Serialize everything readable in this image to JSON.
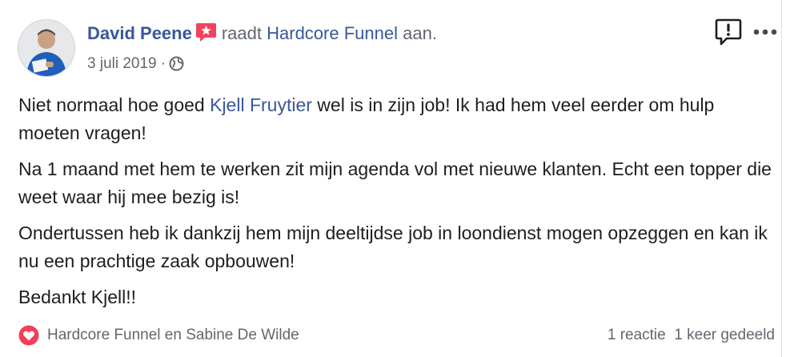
{
  "post": {
    "author": "David Peene",
    "recommends_text": "raadt",
    "page_name": "Hardcore Funnel",
    "recommends_suffix": "aan.",
    "date": "3 juli 2019",
    "separator": "·",
    "body": {
      "p1_before": "Niet normaal hoe goed ",
      "p1_mention": "Kjell Fruytier",
      "p1_after": " wel is in zijn job! Ik had hem veel eerder om hulp moeten vragen!",
      "p2": "Na 1 maand met hem te werken zit mijn agenda vol met nieuwe klanten. Echt een topper die weet waar hij mee bezig is!",
      "p3": "Ondertussen heb ik dankzij hem mijn deeltijdse job in loondienst mogen opzeggen en kan ik nu een prachtige zaak opbouwen!",
      "p4": "Bedankt Kjell!!"
    }
  },
  "footer": {
    "reactors": "Hardcore Funnel en Sabine De Wilde",
    "reactions_count": "1 reactie",
    "shares_count": "1 keer gedeeld"
  },
  "icons": {
    "recommend": "recommend-star-icon",
    "audience": "globe-icon",
    "report": "report-icon",
    "more": "more-options-icon",
    "reaction": "love-reaction-icon"
  },
  "colors": {
    "link": "#385898",
    "secondary_text": "#616770",
    "recommend_badge": "#f3425f",
    "love_reaction": "#f33e58"
  }
}
